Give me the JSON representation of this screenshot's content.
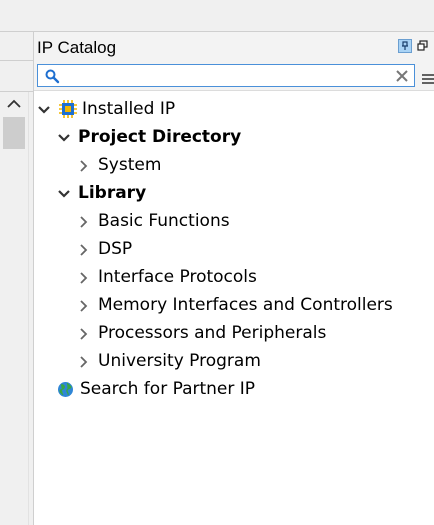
{
  "panel": {
    "title": "IP Catalog",
    "pin_icon": "pin-icon",
    "float_icon": "float-window-icon"
  },
  "search": {
    "value": "",
    "placeholder": "",
    "icon": "search-icon",
    "clear_icon": "clear-icon",
    "menu_icon": "menu-icon"
  },
  "tree": {
    "installed": {
      "label": "Installed IP",
      "icon": "ip-chip-icon"
    },
    "project_directory": {
      "label": "Project Directory"
    },
    "system": {
      "label": "System"
    },
    "library": {
      "label": "Library"
    },
    "library_items": [
      {
        "label": "Basic Functions"
      },
      {
        "label": "DSP"
      },
      {
        "label": "Interface Protocols"
      },
      {
        "label": "Memory Interfaces and Controllers"
      },
      {
        "label": "Processors and Peripherals"
      },
      {
        "label": "University Program"
      }
    ],
    "partner": {
      "label": "Search for Partner IP",
      "icon": "globe-icon"
    }
  },
  "colors": {
    "accent": "#4a90d9",
    "pin_bg": "#a9d3f5",
    "chevron": "#555555"
  }
}
